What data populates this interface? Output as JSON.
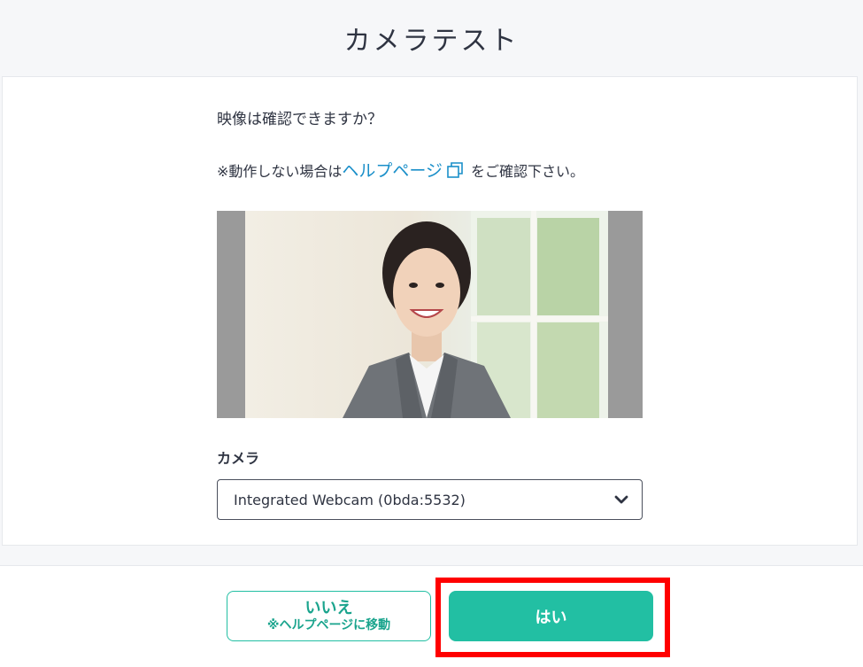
{
  "page": {
    "title": "カメラテスト",
    "question": "映像は確認できますか？",
    "help_prefix": "※動作しない場合は",
    "help_link": "ヘルプページ",
    "help_suffix": "をご確認下さい。"
  },
  "camera": {
    "label": "カメラ",
    "selected": "Integrated Webcam (0bda:5532)"
  },
  "buttons": {
    "no_line1": "いいえ",
    "no_line2": "※ヘルプページに移動",
    "yes": "はい"
  },
  "colors": {
    "accent": "#22bfa3",
    "link": "#1a8fc9",
    "highlight": "#ff0000"
  }
}
